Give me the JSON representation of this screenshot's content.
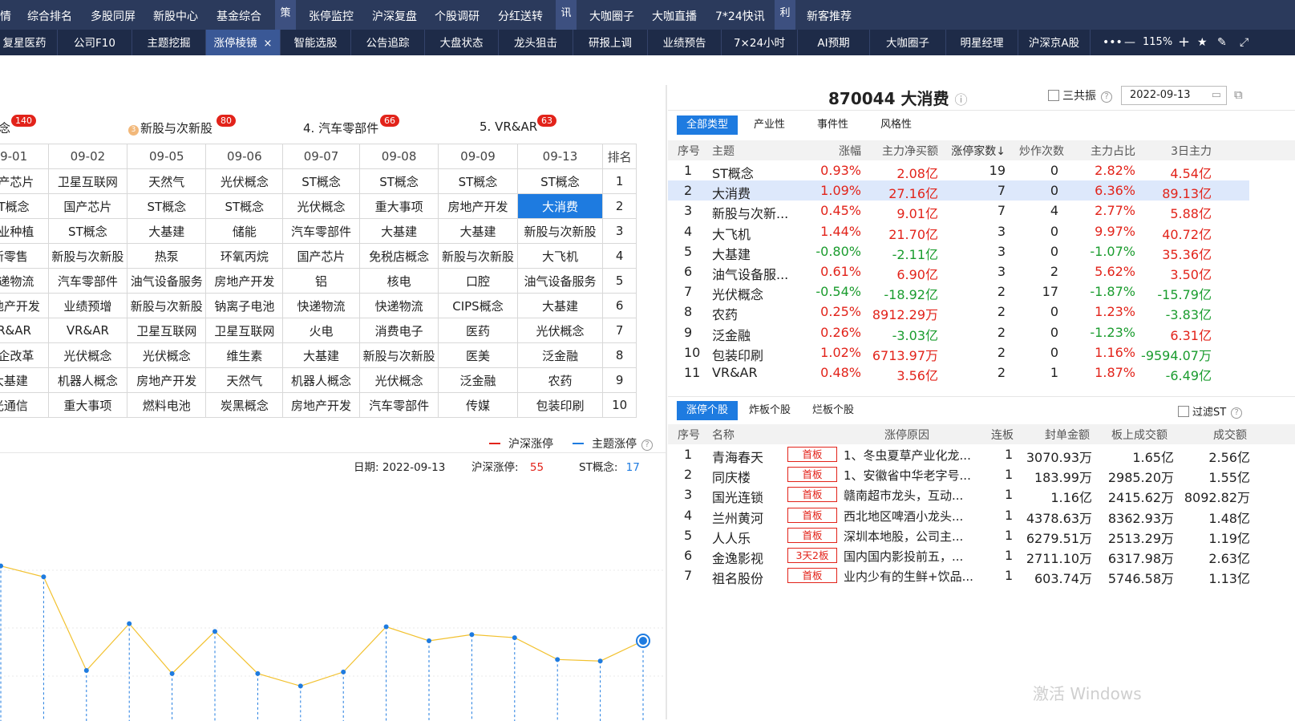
{
  "top_menu": {
    "items": [
      {
        "label": "情",
        "x": 0
      },
      {
        "label": "综合排名",
        "x": 34
      },
      {
        "label": "多股同屏",
        "x": 113
      },
      {
        "label": "新股中心",
        "x": 191
      },
      {
        "label": "基金综合",
        "x": 270
      }
    ],
    "badges": [
      {
        "label": "策",
        "x": 343
      },
      {
        "label": "讯",
        "x": 693
      },
      {
        "label": "利",
        "x": 966
      }
    ],
    "items2": [
      {
        "label": "张停监控",
        "x": 385
      },
      {
        "label": "沪深复盘",
        "x": 464
      },
      {
        "label": "个股调研",
        "x": 542
      },
      {
        "label": "分红送转",
        "x": 621
      },
      {
        "label": "大咖圈子",
        "x": 735
      },
      {
        "label": "大咖直播",
        "x": 813
      },
      {
        "label": "7*24快讯",
        "x": 892
      },
      {
        "label": "新客推荐",
        "x": 1006
      }
    ]
  },
  "tabs": [
    {
      "label": "复星医药"
    },
    {
      "label": "公司F10"
    },
    {
      "label": "主题挖掘"
    },
    {
      "label": "涨停棱镜",
      "active": true,
      "close": "×"
    },
    {
      "label": "智能选股"
    },
    {
      "label": "公告追踪"
    },
    {
      "label": "大盘状态"
    },
    {
      "label": "龙头狙击"
    },
    {
      "label": "研报上调"
    },
    {
      "label": "业绩预告"
    },
    {
      "label": "7×24小时"
    },
    {
      "label": "AI预期"
    },
    {
      "label": "大咖圈子"
    },
    {
      "label": "明星经理"
    },
    {
      "label": "沪深京A股"
    }
  ],
  "toolbar": {
    "more": "•••",
    "minus": "—",
    "zoom": "115%",
    "plus": "+",
    "star": "★",
    "edit": "✎",
    "expand": "⤢"
  },
  "rank_header": [
    {
      "label": "念",
      "badge": "140"
    },
    {
      "label": "新股与次新股",
      "badge": "80",
      "coin": "3"
    },
    {
      "label": "4. 汽车零部件",
      "badge": "66"
    },
    {
      "label": "5. VR&AR",
      "badge": "63"
    }
  ],
  "grid": {
    "headers": [
      "09-01",
      "09-02",
      "09-05",
      "09-06",
      "09-07",
      "09-08",
      "09-09",
      "09-13",
      "排名"
    ],
    "rows": [
      [
        "国产芯片",
        "卫星互联网",
        "天然气",
        "光伏概念",
        "ST概念",
        "ST概念",
        "ST概念",
        "ST概念",
        "1"
      ],
      [
        "ST概念",
        "国产芯片",
        "ST概念",
        "ST概念",
        "光伏概念",
        "重大事项",
        "房地产开发",
        "大消费",
        "2"
      ],
      [
        "农业种植",
        "ST概念",
        "大基建",
        "储能",
        "汽车零部件",
        "大基建",
        "大基建",
        "新股与次新股",
        "3"
      ],
      [
        "新零售",
        "新股与次新股",
        "热泵",
        "环氧丙烷",
        "国产芯片",
        "免税店概念",
        "新股与次新股",
        "大飞机",
        "4"
      ],
      [
        "快递物流",
        "汽车零部件",
        "油气设备服务",
        "房地产开发",
        "铝",
        "核电",
        "口腔",
        "油气设备服务",
        "5"
      ],
      [
        "房地产开发",
        "业绩预增",
        "新股与次新股",
        "钠离子电池",
        "快递物流",
        "快递物流",
        "CIPS概念",
        "大基建",
        "6"
      ],
      [
        "VR&AR",
        "VR&AR",
        "卫星互联网",
        "卫星互联网",
        "火电",
        "消费电子",
        "医药",
        "光伏概念",
        "7"
      ],
      [
        "国企改革",
        "光伏概念",
        "光伏概念",
        "维生素",
        "大基建",
        "新股与次新股",
        "医美",
        "泛金融",
        "8"
      ],
      [
        "大基建",
        "机器人概念",
        "房地产开发",
        "天然气",
        "机器人概念",
        "光伏概念",
        "泛金融",
        "农药",
        "9"
      ],
      [
        "光通信",
        "重大事项",
        "燃料电池",
        "炭黑概念",
        "房地产开发",
        "汽车零部件",
        "传媒",
        "包装印刷",
        "10"
      ]
    ],
    "selected": {
      "row": 1,
      "col": 7
    }
  },
  "chart_legend": {
    "s1": "沪深涨停",
    "s2": "主题涨停"
  },
  "chart_info": {
    "date_label": "日期:",
    "date": "2022-09-13",
    "hs_label": "沪深涨停:",
    "hs_value": "55",
    "st_label": "ST概念:",
    "st_value": "17"
  },
  "chart_data": {
    "type": "line",
    "series": [
      {
        "name": "主题涨停",
        "values": [
          64,
          57,
          -3,
          27,
          -5,
          22,
          -5,
          -13,
          -4,
          25,
          16,
          20,
          18,
          4,
          3,
          16
        ]
      }
    ],
    "x": [
      0,
      1,
      2,
      3,
      4,
      5,
      6,
      7,
      8,
      9,
      10,
      11,
      12,
      13,
      14,
      15
    ]
  },
  "right": {
    "title": "870044 大消费",
    "info_icon": "ⓘ",
    "resonance": "三共振",
    "date": "2022-09-13",
    "seg1": [
      "全部类型",
      "产业性",
      "事件性",
      "风格性"
    ],
    "theme_headers": [
      "序号",
      "主题",
      "涨幅",
      "主力净买额",
      "涨停家数↓",
      "炒作次数",
      "主力占比",
      "3日主力"
    ],
    "themes": [
      [
        "1",
        "ST概念",
        "0.93%",
        "2.08亿",
        "19",
        "0",
        "2.82%",
        "4.54亿"
      ],
      [
        "2",
        "大消费",
        "1.09%",
        "27.16亿",
        "7",
        "0",
        "6.36%",
        "89.13亿"
      ],
      [
        "3",
        "新股与次新...",
        "0.45%",
        "9.01亿",
        "7",
        "4",
        "2.77%",
        "5.88亿"
      ],
      [
        "4",
        "大飞机",
        "1.44%",
        "21.70亿",
        "3",
        "0",
        "9.97%",
        "40.72亿"
      ],
      [
        "5",
        "大基建",
        "-0.80%",
        "-2.11亿",
        "3",
        "0",
        "-1.07%",
        "35.36亿"
      ],
      [
        "6",
        "油气设备服...",
        "0.61%",
        "6.90亿",
        "3",
        "2",
        "5.62%",
        "3.50亿"
      ],
      [
        "7",
        "光伏概念",
        "-0.54%",
        "-18.92亿",
        "2",
        "17",
        "-1.87%",
        "-15.79亿"
      ],
      [
        "8",
        "农药",
        "0.25%",
        "8912.29万",
        "2",
        "0",
        "1.23%",
        "-3.83亿"
      ],
      [
        "9",
        "泛金融",
        "0.26%",
        "-3.03亿",
        "2",
        "0",
        "-1.23%",
        "6.31亿"
      ],
      [
        "10",
        "包装印刷",
        "1.02%",
        "6713.97万",
        "2",
        "0",
        "1.16%",
        "-9594.07万"
      ],
      [
        "11",
        "VR&AR",
        "0.48%",
        "3.56亿",
        "2",
        "1",
        "1.87%",
        "-6.49亿"
      ]
    ],
    "seg2": [
      "涨停个股",
      "炸板个股",
      "烂板个股"
    ],
    "filter_st": "过滤ST",
    "stock_headers": [
      "序号",
      "名称",
      "涨停原因",
      "连板",
      "封单金额",
      "板上成交额",
      "成交额"
    ],
    "stocks": [
      [
        "1",
        "青海春天",
        "首板",
        "1、冬虫夏草产业化龙...",
        "1",
        "3070.93万",
        "1.65亿",
        "2.56亿"
      ],
      [
        "2",
        "同庆楼",
        "首板",
        "1、安徽省中华老字号...",
        "1",
        "183.99万",
        "2985.20万",
        "1.55亿"
      ],
      [
        "3",
        "国光连锁",
        "首板",
        "赣南超市龙头，互动...",
        "1",
        "1.16亿",
        "2415.62万",
        "8092.82万"
      ],
      [
        "4",
        "兰州黄河",
        "首板",
        "西北地区啤酒小龙头...",
        "1",
        "4378.63万",
        "8362.93万",
        "1.48亿"
      ],
      [
        "5",
        "人人乐",
        "首板",
        "深圳本地股，公司主...",
        "1",
        "6279.51万",
        "2513.29万",
        "1.19亿"
      ],
      [
        "6",
        "金逸影视",
        "3天2板",
        "国内国内影投前五，...",
        "1",
        "2711.10万",
        "6317.98万",
        "2.63亿"
      ],
      [
        "7",
        "祖名股份",
        "首板",
        "业内少有的生鲜+饮品...",
        "1",
        "603.74万",
        "5746.58万",
        "1.13亿"
      ]
    ],
    "watermark": "激活 Windows"
  }
}
